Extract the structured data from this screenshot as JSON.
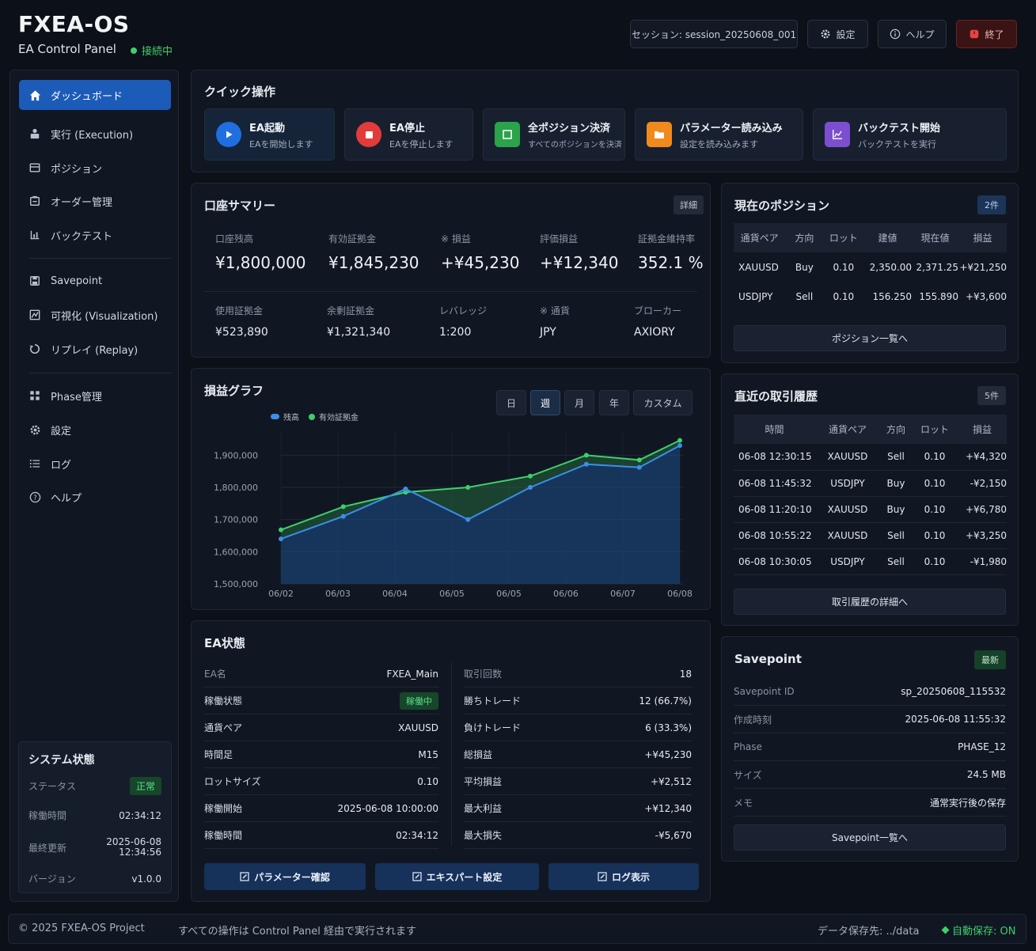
{
  "header": {
    "title": "FXEA-OS",
    "subtitle": "EA Control Panel",
    "connection": "接続中",
    "session": "セッション: session_20250608_001",
    "settings": "設定",
    "help": "ヘルプ",
    "exit": "終了"
  },
  "sidebar": {
    "items": [
      {
        "label": "ダッシュボード",
        "icon": "home-icon"
      },
      {
        "label": "実行 (Execution)",
        "icon": "execution-icon"
      },
      {
        "label": "ポジション",
        "icon": "position-icon"
      },
      {
        "label": "オーダー管理",
        "icon": "order-icon"
      },
      {
        "label": "バックテスト",
        "icon": "backtest-icon"
      },
      {
        "label": "Savepoint",
        "icon": "savepoint-icon"
      },
      {
        "label": "可視化 (Visualization)",
        "icon": "visualization-icon"
      },
      {
        "label": "リプレイ (Replay)",
        "icon": "replay-icon"
      },
      {
        "label": "Phase管理",
        "icon": "phase-icon"
      },
      {
        "label": "設定",
        "icon": "gear-icon"
      },
      {
        "label": "ログ",
        "icon": "list-icon"
      },
      {
        "label": "ヘルプ",
        "icon": "help-icon"
      }
    ]
  },
  "system": {
    "title": "システム状態",
    "rows": [
      {
        "k": "ステータス",
        "v": "正常"
      },
      {
        "k": "稼働時間",
        "v": "02:34:12"
      },
      {
        "k": "最終更新",
        "v": "2025-06-08 12:34:56"
      },
      {
        "k": "バージョン",
        "v": "v1.0.0"
      }
    ]
  },
  "quick": {
    "title": "クイック操作",
    "buttons": [
      {
        "title": "EA起動",
        "desc": "EAを開始します",
        "color": "#1f6fe0"
      },
      {
        "title": "EA停止",
        "desc": "EAを停止します",
        "color": "#e23b3b"
      },
      {
        "title": "全ポジション決済",
        "desc": "すべてのポジションを決済",
        "color": "#2aa34a"
      },
      {
        "title": "パラメーター読み込み",
        "desc": "設定を読み込みます",
        "color": "#f08a1c"
      },
      {
        "title": "バックテスト開始",
        "desc": "バックテストを実行",
        "color": "#7b4fd0"
      }
    ]
  },
  "summary": {
    "title": "口座サマリー",
    "detail": "詳細",
    "top": [
      {
        "label": "口座残高",
        "value": "¥1,800,000"
      },
      {
        "label": "有効証拠金",
        "value": "¥1,845,230"
      },
      {
        "label": "※ 損益",
        "value": "+¥45,230"
      },
      {
        "label": "評価損益",
        "value": "+¥12,340"
      },
      {
        "label": "証拠金維持率",
        "value": "352.1 %"
      }
    ],
    "bottom": [
      {
        "label": "使用証拠金",
        "value": "¥523,890"
      },
      {
        "label": "余剰証拠金",
        "value": "¥1,321,340"
      },
      {
        "label": "レバレッジ",
        "value": "1:200"
      },
      {
        "label": "※ 通貨",
        "value": "JPY"
      },
      {
        "label": "ブローカー",
        "value": "AXIORY"
      }
    ]
  },
  "positions": {
    "title": "現在のポジション",
    "count": "2件",
    "headers": [
      "通貨ペア",
      "方向",
      "ロット",
      "建値",
      "現在値",
      "損益"
    ],
    "rows": [
      [
        "XAUUSD",
        "Buy",
        "0.10",
        "2,350.00",
        "2,371.25",
        "+¥21,250"
      ],
      [
        "USDJPY",
        "Sell",
        "0.10",
        "156.250",
        "155.890",
        "+¥3,600"
      ]
    ],
    "link": "ポジション一覧へ"
  },
  "history": {
    "title": "直近の取引履歴",
    "count": "5件",
    "headers": [
      "時間",
      "通貨ペア",
      "方向",
      "ロット",
      "損益"
    ],
    "rows": [
      [
        "06-08 12:30:15",
        "XAUUSD",
        "Sell",
        "0.10",
        "+¥4,320"
      ],
      [
        "06-08 11:45:32",
        "USDJPY",
        "Buy",
        "0.10",
        "-¥2,150"
      ],
      [
        "06-08 11:20:10",
        "XAUUSD",
        "Buy",
        "0.10",
        "+¥6,780"
      ],
      [
        "06-08 10:55:22",
        "XAUUSD",
        "Sell",
        "0.10",
        "+¥3,250"
      ],
      [
        "06-08 10:30:05",
        "USDJPY",
        "Sell",
        "0.10",
        "-¥1,980"
      ]
    ],
    "link": "取引履歴の詳細へ"
  },
  "chart_panel": {
    "title": "損益グラフ",
    "tabs": [
      "日",
      "週",
      "月",
      "年",
      "カスタム"
    ],
    "active_tab": "週"
  },
  "chart_data": {
    "type": "area",
    "categories": [
      "06/02",
      "06/03",
      "06/04",
      "06/05",
      "06/05",
      "06/06",
      "06/07",
      "06/08"
    ],
    "x": [
      0,
      1,
      2,
      3,
      4,
      5,
      6,
      7
    ],
    "series": [
      {
        "name": "残高",
        "color": "#3b8fe8",
        "points": [
          [
            0,
            1640000
          ],
          [
            1,
            1710000
          ],
          [
            2,
            1795000
          ],
          [
            3,
            1700000
          ],
          [
            4,
            1800000
          ],
          [
            4.9,
            1872000
          ],
          [
            5.75,
            1862000
          ],
          [
            6.4,
            1930000
          ]
        ]
      },
      {
        "name": "有効証拠金",
        "color": "#3fcf6a",
        "points": [
          [
            0,
            1668000
          ],
          [
            1,
            1740000
          ],
          [
            2,
            1785000
          ],
          [
            3,
            1800000
          ],
          [
            4,
            1835000
          ],
          [
            4.9,
            1900000
          ],
          [
            5.75,
            1885000
          ],
          [
            6.4,
            1946000
          ]
        ]
      }
    ],
    "yticks": [
      "1,900,000",
      "1,800,000",
      "1,700,000",
      "1,600,000",
      "1,500,000"
    ],
    "ylim": [
      1500000,
      1950000
    ],
    "grid": true,
    "legend": "top-left"
  },
  "ea": {
    "title": "EA状態",
    "left": [
      {
        "k": "EA名",
        "v": "FXEA_Main"
      },
      {
        "k": "稼働状態",
        "v": "稼働中"
      },
      {
        "k": "通貨ペア",
        "v": "XAUUSD"
      },
      {
        "k": "時間足",
        "v": "M15"
      },
      {
        "k": "ロットサイズ",
        "v": "0.10"
      },
      {
        "k": "稼働開始",
        "v": "2025-06-08 10:00:00"
      },
      {
        "k": "稼働時間",
        "v": "02:34:12"
      }
    ],
    "right": [
      {
        "k": "取引回数",
        "v": "18"
      },
      {
        "k": "勝ちトレード",
        "v": "12 (66.7%)"
      },
      {
        "k": "負けトレード",
        "v": "6 (33.3%)"
      },
      {
        "k": "総損益",
        "v": "+¥45,230"
      },
      {
        "k": "平均損益",
        "v": "+¥2,512"
      },
      {
        "k": "最大利益",
        "v": "+¥12,340"
      },
      {
        "k": "最大損失",
        "v": "-¥5,670"
      }
    ],
    "buttons": [
      "パラメーター確認",
      "エキスパート設定",
      "ログ表示"
    ]
  },
  "savepoint": {
    "title": "Savepoint",
    "badge": "最新",
    "rows": [
      {
        "k": "Savepoint ID",
        "v": "sp_20250608_115532"
      },
      {
        "k": "作成時刻",
        "v": "2025-06-08 11:55:32"
      },
      {
        "k": "Phase",
        "v": "PHASE_12"
      },
      {
        "k": "サイズ",
        "v": "24.5 MB"
      },
      {
        "k": "メモ",
        "v": "通常実行後の保存"
      }
    ],
    "link": "Savepoint一覧へ"
  },
  "footer": {
    "copyright": "© 2025 FXEA-OS Project",
    "note": "すべての操作は Control Panel 経由で実行されます",
    "data_path": "データ保存先: ../data",
    "autosave": "自動保存: ON"
  }
}
